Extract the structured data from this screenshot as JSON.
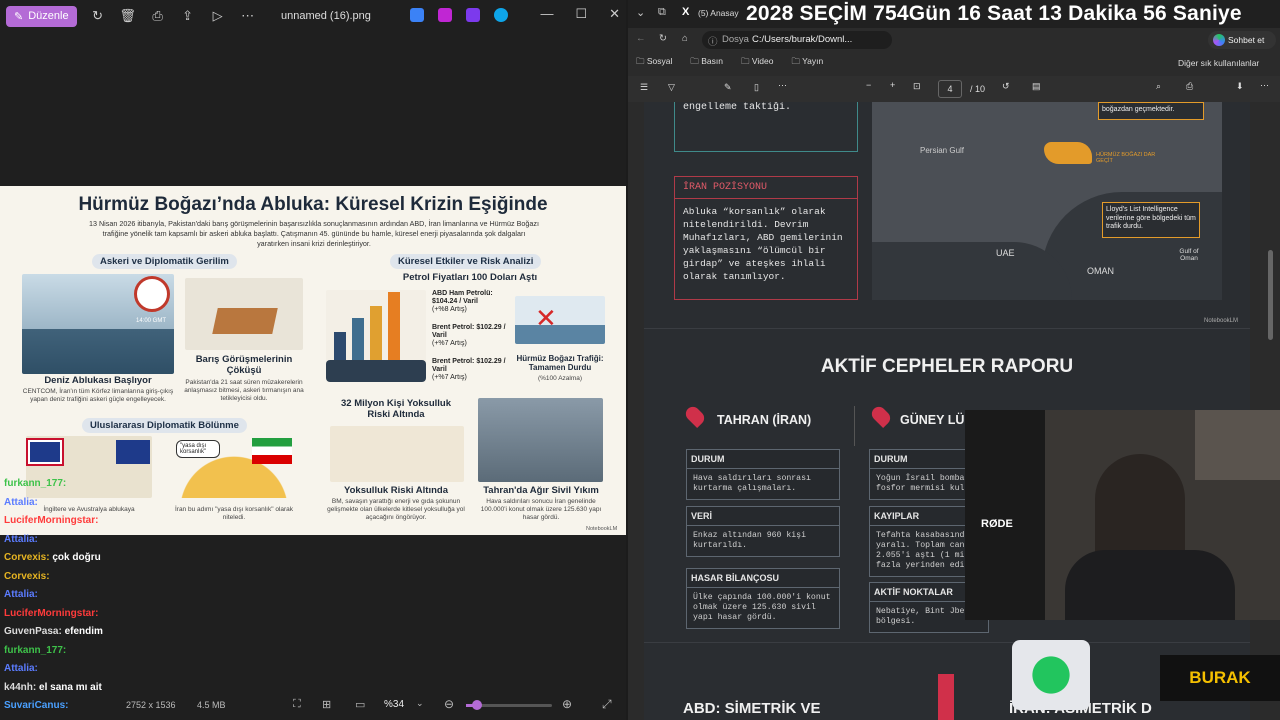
{
  "left": {
    "toolbar": {
      "edit_label": "Düzenle",
      "filename": "unnamed (16).png"
    },
    "infographic": {
      "title": "Hürmüz Boğazı’nda Abluka: Küresel Krizin Eşiğinde",
      "intro": "13 Nisan 2026 itibarıyla, Pakistan'daki barış görüşmelerinin başarısızlıkla sonuçlanmasının ardından ABD, İran limanlarına ve Hürmüz Boğazı trafiğine yönelik tam kapsamlı bir askeri abluka başlattı. Çatışmanın 45. gününde bu hamle, küresel enerji piyasalarında şok dalgaları yaratırken insani krizi derinleştiriyor.",
      "sec_military": "Askeri ve Diplomatik Gerilim",
      "sec_global": "Küresel Etkiler ve Risk Analizi",
      "oil_head": "Petrol Fiyatları 100 Doları Aştı",
      "clock_time": "14:00 GMT",
      "blockade_cap": "Deniz Ablukası Başlıyor",
      "blockade_sub": "CENTCOM, İran'ın tüm Körfez limanlarına giriş-çıkış yapan deniz trafiğini askeri güçle engelleyecek.",
      "talks_cap": "Barış Görüşmelerinin Çöküşü",
      "talks_sub": "Pakistan'da 21 saat süren müzakerelerin anlaşmasız bitmesi, askeri tırmanışın ana tetikleyicisi oldu.",
      "oil1": "ABD Ham Petrolü: $104.24 / Varil",
      "oil1_sub": "(+%8 Artış)",
      "oil2": "Brent Petrol: $102.29 / Varil",
      "oil2_sub": "(+%7 Artış)",
      "oil3": "Brent Petrol: $102.29 / Varil",
      "oil3_sub": "(+%7 Artış)",
      "traffic_cap": "Hürmüz Boğazı Trafiği: Tamamen Durdu",
      "traffic_sub": "(%100 Azalma)",
      "poverty_head": "32 Milyon Kişi Yoksulluk Riski Altında",
      "sec_diplo": "Uluslararası Diplomatik Bölünme",
      "diplo_sub1": "İngiltere ve Avustralya ablukaya",
      "bubble": "\"yasa dışı korsanlık\"",
      "diplo_sub2": "İran bu adımı \"yasa dışı korsanlık\" olarak niteledi.",
      "poverty_cap": "Yoksulluk Riski Altında",
      "poverty_sub": "BM, savaşın yarattığı enerji ve gıda şokunun gelişmekte olan ülkelerde kitlesel yoksulluğa yol açacağını öngörüyor.",
      "tahran_cap": "Tahran'da Ağır Sivil Yıkım",
      "tahran_sub": "Hava saldırıları sonucu İran genelinde 100.000'i konut olmak üzere 125.630 yapı hasar gördü.",
      "brand": "NotebookLM"
    },
    "chat": [
      {
        "user": "furkann_177:",
        "msg": "",
        "color": "#3ec24a"
      },
      {
        "user": "Attalia:",
        "msg": "",
        "color": "#5b7cff"
      },
      {
        "user": "LuciferMorningstar:",
        "msg": "",
        "color": "#ff3b3b"
      },
      {
        "user": "Attalia:",
        "msg": "",
        "color": "#5b7cff"
      },
      {
        "user": "Corvexis:",
        "msg": "çok doğru",
        "color": "#e6b422"
      },
      {
        "user": "Corvexis:",
        "msg": "",
        "color": "#e6b422"
      },
      {
        "user": "Attalia:",
        "msg": "",
        "color": "#5b7cff"
      },
      {
        "user": "LuciferMorningstar:",
        "msg": "",
        "color": "#ff3b3b"
      },
      {
        "user": "GuvenPasa:",
        "msg": "efendim",
        "color": "#dddddd"
      },
      {
        "user": "furkann_177:",
        "msg": "",
        "color": "#3ec24a"
      },
      {
        "user": "Attalia:",
        "msg": "",
        "color": "#5b7cff"
      },
      {
        "user": "k44nh:",
        "msg": "el sana mı ait",
        "color": "#dddddd"
      },
      {
        "user": "SuvariCanus:",
        "msg": "",
        "color": "#4aa0ff"
      }
    ],
    "status": {
      "dims": "2752 x 1536",
      "size": "4.5 MB",
      "zoom": "%34"
    }
  },
  "right": {
    "tab_label": "(5) Anasay",
    "countdown": "2028 SEÇİM  754Gün  16 Saat  13 Dakika  56 Saniye",
    "address": {
      "prefix": "Dosya",
      "path": "C:/Users/burak/Downl...",
      "copilot": "Sohbet et"
    },
    "bookmarks": [
      "Sosyal",
      "Basın",
      "Video",
      "Yayın"
    ],
    "other_bookmarks": "Diğer sık kullanılanlar",
    "pdf": {
      "page": "4",
      "total": "/ 10"
    },
    "doc": {
      "top_card_text": "engelleme taktiği.",
      "iran_head": "İRAN POZİSYONU",
      "iran_text": "Abluka “korsanlık” olarak nitelendirildi. Devrim Muhafızları, ABD gemilerinin yaklaşmasını “ölümcül bir girdap” ve ateşkes ihlali olarak tanımlıyor.",
      "map_labels": {
        "persian_gulf": "Persian Gulf",
        "uae": "UAE",
        "oman": "OMAN",
        "gulf_of_oman": "Gulf of Oman",
        "strait": "HÜRMÜZ BOĞAZI DAR GEÇİT",
        "callout1": "boğazdan geçmektedir.",
        "callout2": "Lloyd's List Intelligence verilerine göre bölgedeki tüm trafik durdu."
      },
      "brand": "NotebookLM",
      "report_title": "AKTİF CEPHELER RAPORU",
      "loc1": "TAHRAN (İRAN)",
      "loc2": "GÜNEY LÜ",
      "c1": [
        {
          "h": "DURUM",
          "b": "Hava saldırıları sonrası kurtarma çalışmaları."
        },
        {
          "h": "VERİ",
          "b": "Enkaz altından 960 kişi kurtarıldı."
        },
        {
          "h": "HASAR BİLANÇOSU",
          "b": "Ülke çapında 100.000'i konut olmak üzere 125.630 sivil yapı hasar gördü."
        }
      ],
      "c2": [
        {
          "h": "DURUM",
          "b": "Yoğun İsrail bomba fosfor mermisi kul"
        },
        {
          "h": "KAYIPLAR",
          "b": "Tefahta kasabasında yaralı. Toplam can 2.055'i aştı (1 mi fazla yerinden edi"
        },
        {
          "h": "AKTİF NOKTALAR",
          "b": "Nebatiye, Bint Jbe bölgesi."
        }
      ],
      "bottom_left": "ABD: SİMETRİK VE",
      "bottom_right": "İRAN: ASİMETRİK D"
    },
    "overlay": {
      "mic_brand": "RØDE",
      "logo": "BURAK"
    }
  }
}
